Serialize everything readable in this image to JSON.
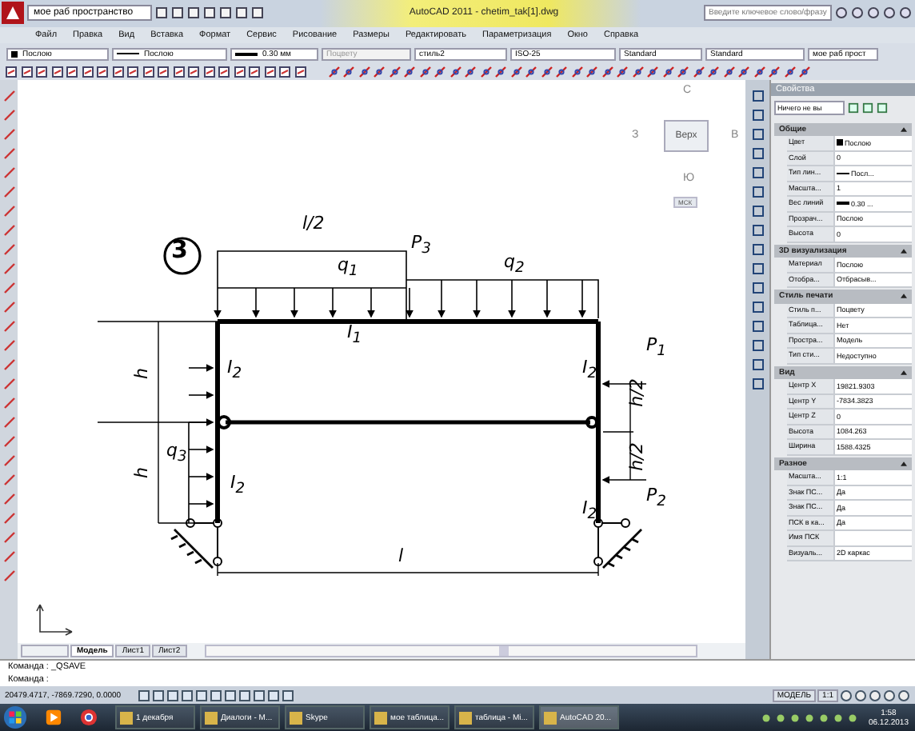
{
  "title_bar": {
    "workspace": "мое раб пространство",
    "title": "AutoCAD 2011 - chetim_tak[1].dwg",
    "search": {
      "placeholder": "Введите ключевое слово/фразу"
    }
  },
  "menu": [
    "Файл",
    "Правка",
    "Вид",
    "Вставка",
    "Формат",
    "Сервис",
    "Рисование",
    "Размеры",
    "Редактировать",
    "Параметризация",
    "Окно",
    "Справка"
  ],
  "properties_toolbar": [
    {
      "kind": "color",
      "value": "Послою",
      "disabled": false
    },
    {
      "kind": "line",
      "value": "Послою",
      "disabled": false
    },
    {
      "kind": "weight",
      "value": "0.30 мм",
      "disabled": false
    },
    {
      "kind": "text",
      "value": "Поцвету",
      "disabled": true
    },
    {
      "kind": "text",
      "value": "стиль2",
      "disabled": false
    },
    {
      "kind": "text",
      "value": "ISO-25",
      "disabled": false
    },
    {
      "kind": "text",
      "value": "Standard",
      "disabled": false
    },
    {
      "kind": "text",
      "value": "Standard",
      "disabled": false
    },
    {
      "kind": "text",
      "value": "мое раб прост",
      "disabled": false
    }
  ],
  "viewcube": {
    "north": "С",
    "west": "З",
    "east": "В",
    "south": "Ю",
    "face": "Верх",
    "ucs": "МСК"
  },
  "drawing": {
    "labels": [
      {
        "text": "3"
      },
      {
        "text": "l/2"
      },
      {
        "text": "P$_{3}$"
      },
      {
        "text": "q$_{1}$"
      },
      {
        "text": "q$_{2}$"
      },
      {
        "text": "I$_{1}$"
      },
      {
        "text": "I$_{2}$"
      },
      {
        "text": "h"
      },
      {
        "text": "I$_{2}$"
      },
      {
        "text": "P$_{1}$"
      },
      {
        "text": "h/2"
      },
      {
        "text": "h/2"
      },
      {
        "text": "q$_{3}$"
      },
      {
        "text": "h"
      },
      {
        "text": "I$_{2}$"
      },
      {
        "text": "I$_{2}$"
      },
      {
        "text": "P$_{2}$"
      },
      {
        "text": "l"
      }
    ]
  },
  "layout_tabs": [
    {
      "label": "Модель",
      "selected": true
    },
    {
      "label": "Лист1",
      "selected": false
    },
    {
      "label": "Лист2",
      "selected": false
    }
  ],
  "command_lines": [
    "Команда :  _QSAVE",
    "Команда :"
  ],
  "status_bar": {
    "coordinates": "20479.4717, -7869.7290, 0.0000",
    "space": "МОДЕЛЬ",
    "scale": "1:1"
  },
  "palette": {
    "title": "Свойства",
    "selector": "Ничего не вы",
    "sections": [
      {
        "name": "Общие",
        "expanded": true,
        "rows": [
          {
            "key": "Цвет",
            "value": "Послою",
            "kind": "color"
          },
          {
            "key": "Слой",
            "value": "0",
            "kind": "text"
          },
          {
            "key": "Тип лин...",
            "value": "Посл...",
            "kind": "line"
          },
          {
            "key": "Масшта...",
            "value": "1",
            "kind": "text"
          },
          {
            "key": "Вес линий",
            "value": "0.30 ...",
            "kind": "weight"
          },
          {
            "key": "Прозрач...",
            "value": "Послою",
            "kind": "text"
          },
          {
            "key": "Высота",
            "value": "0",
            "kind": "text"
          }
        ]
      },
      {
        "name": "3D визуализация",
        "expanded": true,
        "rows": [
          {
            "key": "Материал",
            "value": "Послою",
            "kind": "text"
          },
          {
            "key": "Отобра...",
            "value": "Отбрасыв...",
            "kind": "text"
          }
        ]
      },
      {
        "name": "Стиль печати",
        "expanded": true,
        "rows": [
          {
            "key": "Стиль п...",
            "value": "Поцвету",
            "kind": "text"
          },
          {
            "key": "Таблица...",
            "value": "Нет",
            "kind": "text"
          },
          {
            "key": "Простра...",
            "value": "Модель",
            "kind": "text"
          },
          {
            "key": "Тип сти...",
            "value": "Недоступно",
            "kind": "text"
          }
        ]
      },
      {
        "name": "Вид",
        "expanded": true,
        "rows": [
          {
            "key": "Центр X",
            "value": "19821.9303",
            "kind": "text"
          },
          {
            "key": "Центр Y",
            "value": "-7834.3823",
            "kind": "text"
          },
          {
            "key": "Центр Z",
            "value": "0",
            "kind": "text"
          },
          {
            "key": "Высота",
            "value": "1084.263",
            "kind": "text"
          },
          {
            "key": "Ширина",
            "value": "1588.4325",
            "kind": "text"
          }
        ]
      },
      {
        "name": "Разное",
        "expanded": true,
        "rows": [
          {
            "key": "Масшта...",
            "value": "1:1",
            "kind": "text"
          },
          {
            "key": "Знак ПС...",
            "value": "Да",
            "kind": "text"
          },
          {
            "key": "Знак ПС...",
            "value": "Да",
            "kind": "text"
          },
          {
            "key": "ПСК в ка...",
            "value": "Да",
            "kind": "text"
          },
          {
            "key": "Имя ПСК",
            "kind": "text"
          },
          {
            "key": "Визуаль...",
            "value": "2D каркас",
            "kind": "text"
          }
        ]
      }
    ]
  },
  "taskbar": {
    "items": [
      {
        "label": "1 декабря",
        "selected": false
      },
      {
        "label": "Диалоги - M...",
        "selected": false
      },
      {
        "label": "Skype",
        "selected": false
      },
      {
        "label": "мое таблица...",
        "selected": false
      },
      {
        "label": "таблица - Mi...",
        "selected": false
      },
      {
        "label": "AutoCAD 20...",
        "selected": true
      }
    ],
    "time": "1:58",
    "date": "06.12.2013"
  }
}
